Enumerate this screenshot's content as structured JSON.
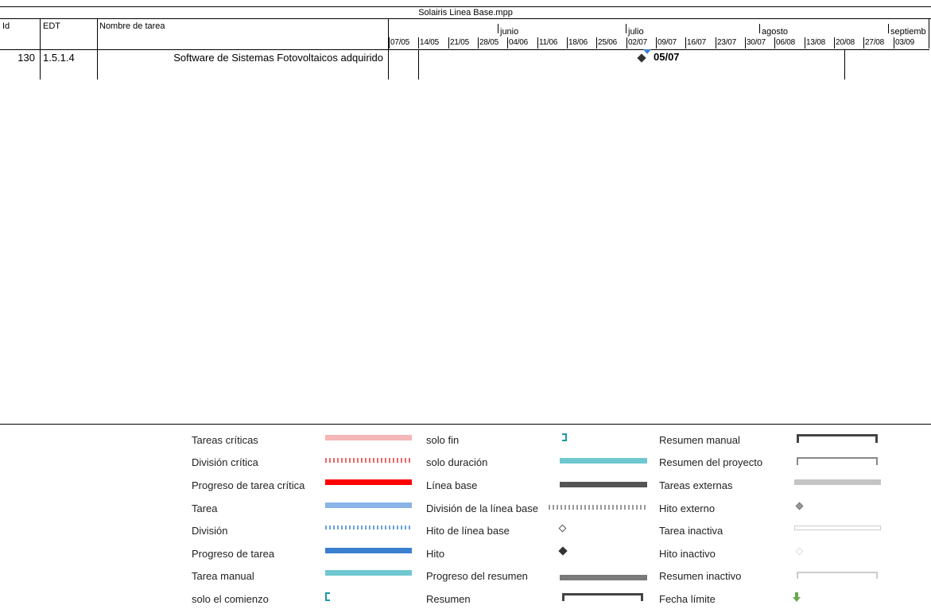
{
  "file_title": "Solairis Linea Base.mpp",
  "columns": {
    "id": "Id",
    "edt": "EDT",
    "name": "Nombre de tarea"
  },
  "months": [
    "junio",
    "julio",
    "agosto",
    "septiemb"
  ],
  "weeks": [
    "07/05",
    "14/05",
    "21/05",
    "28/05",
    "04/06",
    "11/06",
    "18/06",
    "25/06",
    "02/07",
    "09/07",
    "16/07",
    "23/07",
    "30/07",
    "06/08",
    "13/08",
    "20/08",
    "27/08",
    "03/09"
  ],
  "task": {
    "id": "130",
    "edt": "1.5.1.4",
    "name": "Software de Sistemas Fotovoltaicos adquirido",
    "milestone_label": "05/07"
  },
  "legend": {
    "col1": [
      "Tareas críticas",
      "División crítica",
      "Progreso de tarea crítica",
      "Tarea",
      "División",
      "Progreso de tarea",
      "Tarea manual",
      "solo el comienzo"
    ],
    "col2": [
      "solo fin",
      "solo duración",
      "Línea base",
      "División de la línea base",
      "Hito de línea base",
      "Hito",
      "Progreso del resumen",
      "Resumen"
    ],
    "col3": [
      "Resumen manual",
      "Resumen del proyecto",
      "Tareas externas",
      "Hito externo",
      "Tarea inactiva",
      "Hito inactivo",
      "Resumen inactivo",
      "Fecha límite"
    ]
  },
  "colors": {
    "critical": "#f4b6b6",
    "critical_progress": "#ff0000",
    "task": "#8ab4e8",
    "task_progress": "#3b7fd0",
    "manual": "#6fc8d0",
    "baseline": "#555555",
    "summary_progress": "#7a7a7a",
    "external": "#c4c4c4",
    "deadline": "#6aa84f"
  }
}
